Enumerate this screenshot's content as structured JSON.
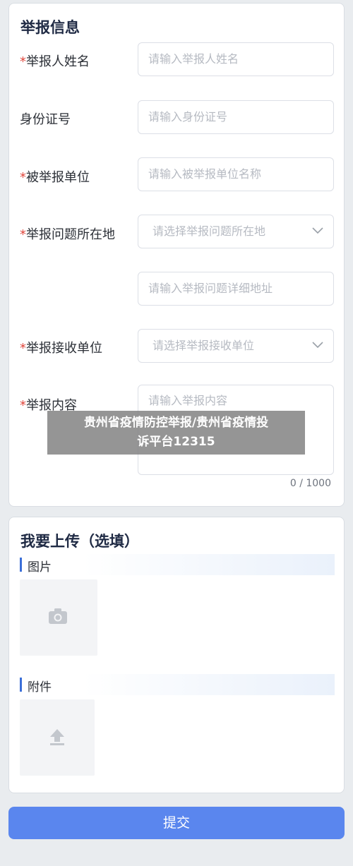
{
  "report_section": {
    "title": "举报信息",
    "required_marker": "*",
    "reporter_name": {
      "label": "举报人姓名",
      "placeholder": "请输入举报人姓名"
    },
    "id_number": {
      "label": "身份证号",
      "placeholder": "请输入身份证号"
    },
    "reported_unit": {
      "label": "被举报单位",
      "placeholder": "请输入被举报单位名称"
    },
    "location": {
      "label": "举报问题所在地",
      "select_placeholder": "请选择举报问题所在地",
      "detail_placeholder": "请输入举报问题详细地址"
    },
    "receiving_unit": {
      "label": "举报接收单位",
      "select_placeholder": "请选择举报接收单位"
    },
    "content": {
      "label": "举报内容",
      "placeholder": "请输入举报内容",
      "counter": "0 / 1000"
    }
  },
  "watermark": {
    "line1": "贵州省疫情防控举报/贵州省疫情投",
    "line2": "诉平台12315"
  },
  "upload_section": {
    "title": "我要上传（选填）",
    "images_label": "图片",
    "attachments_label": "附件",
    "image_icon": "camera-icon",
    "attachment_icon": "upload-arrow-icon"
  },
  "submit_label": "提交",
  "colors": {
    "accent": "#5a86ee",
    "required": "#e0463c",
    "placeholder": "#b6bac2"
  }
}
